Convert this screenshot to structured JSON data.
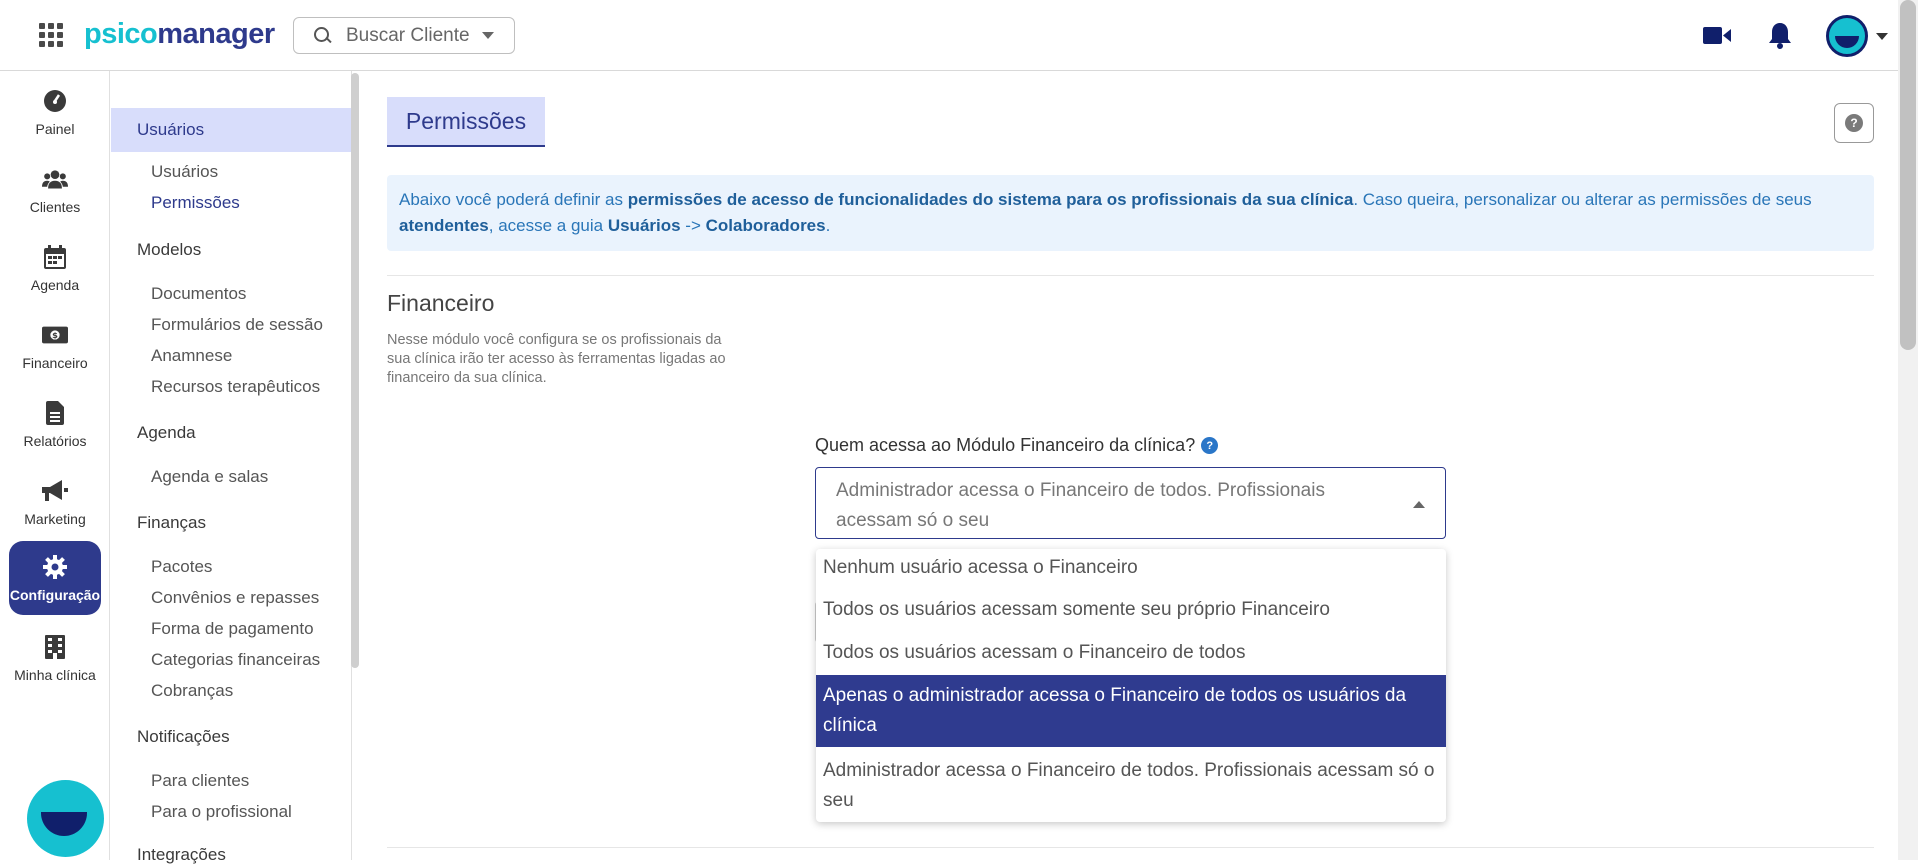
{
  "topbar": {
    "logo_part1": "psico",
    "logo_part2": "manager",
    "search_placeholder": "Buscar Cliente",
    "icons": [
      "apps-grid-icon",
      "search-icon",
      "video-icon",
      "bell-icon",
      "avatar"
    ]
  },
  "rail": {
    "items": [
      {
        "label": "Painel",
        "icon": "dashboard-icon"
      },
      {
        "label": "Clientes",
        "icon": "users-icon"
      },
      {
        "label": "Agenda",
        "icon": "calendar-icon"
      },
      {
        "label": "Financeiro",
        "icon": "money-icon"
      },
      {
        "label": "Relatórios",
        "icon": "report-icon"
      },
      {
        "label": "Marketing",
        "icon": "megaphone-icon"
      },
      {
        "label": "Configuração",
        "icon": "gear-icon",
        "active": true
      },
      {
        "label": "Minha clínica",
        "icon": "building-icon"
      }
    ]
  },
  "subnav": {
    "active_section": "Usuários",
    "usuarios_items": [
      "Usuários",
      "Permissões"
    ],
    "modelos_title": "Modelos",
    "modelos_items": [
      "Documentos",
      "Formulários de sessão",
      "Anamnese",
      "Recursos terapêuticos"
    ],
    "agenda_title": "Agenda",
    "agenda_items": [
      "Agenda e salas"
    ],
    "financas_title": "Finanças",
    "financas_items": [
      "Pacotes",
      "Convênios e repasses",
      "Forma de pagamento",
      "Categorias financeiras",
      "Cobranças"
    ],
    "notificacoes_title": "Notificações",
    "notificacoes_items": [
      "Para clientes",
      "Para o profissional"
    ],
    "integracoes_title": "Integrações"
  },
  "main": {
    "page_title": "Permissões",
    "help_label": "?",
    "info": {
      "t1": "Abaixo você poderá definir as ",
      "b1": "permissões de acesso de funcionalidades do sistema para os profissionais da sua clínica",
      "t2": ". Caso queira, personalizar ou alterar as permissões de seus ",
      "b2": "atendentes",
      "t3": ", acesse a guia ",
      "b3": "Usuários",
      "t4": " -> ",
      "b4": "Colaboradores",
      "t5": "."
    },
    "section_title": "Financeiro",
    "section_desc": "Nesse módulo você configura se os profissionais da sua clínica irão ter acesso às ferramentas ligadas ao financeiro da sua clínica.",
    "field_label": "Quem acessa ao Módulo Financeiro da clínica?",
    "field_info": "?",
    "select_value": "Administrador acessa o Financeiro de todos. Profissionais acessam só o seu",
    "options": [
      "Nenhum usuário acessa o Financeiro",
      "Todos os usuários acessam somente seu próprio Financeiro",
      "Todos os usuários acessam o Financeiro de todos",
      "Apenas o administrador acessa o Financeiro de todos os usuários da clínica",
      "Administrador acessa o Financeiro de todos. Profissionais acessam só o seu"
    ],
    "highlighted_option_index": 3
  },
  "colors": {
    "brand_primary": "#2e3a8c",
    "brand_accent": "#16c0d0",
    "active_bg": "#d8ddfb",
    "info_bg": "#eaf3fd"
  }
}
